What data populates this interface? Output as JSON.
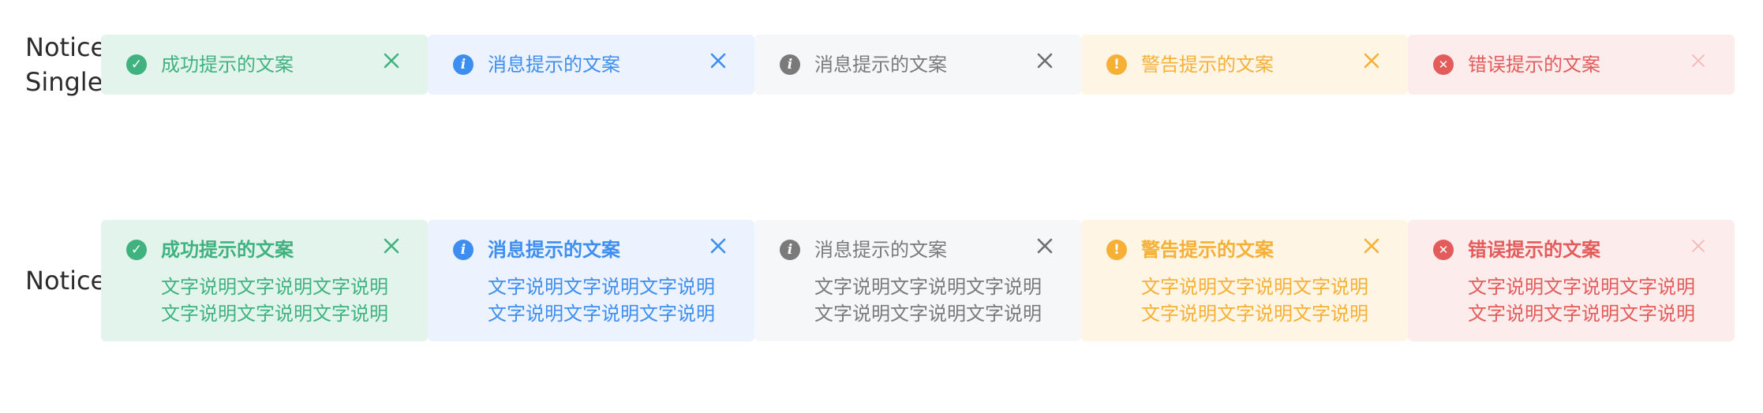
{
  "labels": {
    "single": "Notice Single",
    "multi": "Notice"
  },
  "single_notices": [
    {
      "type": "success",
      "icon": "check-circle-icon",
      "title": "成功提示的文案"
    },
    {
      "type": "info",
      "icon": "info-circle-icon",
      "title": "消息提示的文案"
    },
    {
      "type": "neutral",
      "icon": "info-circle-icon",
      "title": "消息提示的文案"
    },
    {
      "type": "warning",
      "icon": "exclamation-circle-icon",
      "title": "警告提示的文案"
    },
    {
      "type": "error",
      "icon": "error-circle-icon",
      "title": "错误提示的文案"
    }
  ],
  "multi_notices": [
    {
      "type": "success",
      "icon": "check-circle-icon",
      "title": "成功提示的文案",
      "lines": [
        "文字说明文字说明文字说明",
        "文字说明文字说明文字说明"
      ]
    },
    {
      "type": "info",
      "icon": "info-circle-icon",
      "title": "消息提示的文案",
      "lines": [
        "文字说明文字说明文字说明",
        "文字说明文字说明文字说明"
      ]
    },
    {
      "type": "neutral",
      "icon": "info-circle-icon",
      "title": "消息提示的文案",
      "lines": [
        "文字说明文字说明文字说明",
        "文字说明文字说明文字说明"
      ]
    },
    {
      "type": "warning",
      "icon": "exclamation-circle-icon",
      "title": "警告提示的文案",
      "lines": [
        "文字说明文字说明文字说明",
        "文字说明文字说明文字说明"
      ]
    },
    {
      "type": "error",
      "icon": "error-circle-icon",
      "title": "错误提示的文案",
      "lines": [
        "文字说明文字说明文字说明",
        "文字说明文字说明文字说明"
      ]
    }
  ],
  "colors": {
    "success": "#3fb27f",
    "info": "#3d8ef0",
    "neutral": "#7a7a7a",
    "warning": "#f7b035",
    "error": "#e35b5b"
  }
}
